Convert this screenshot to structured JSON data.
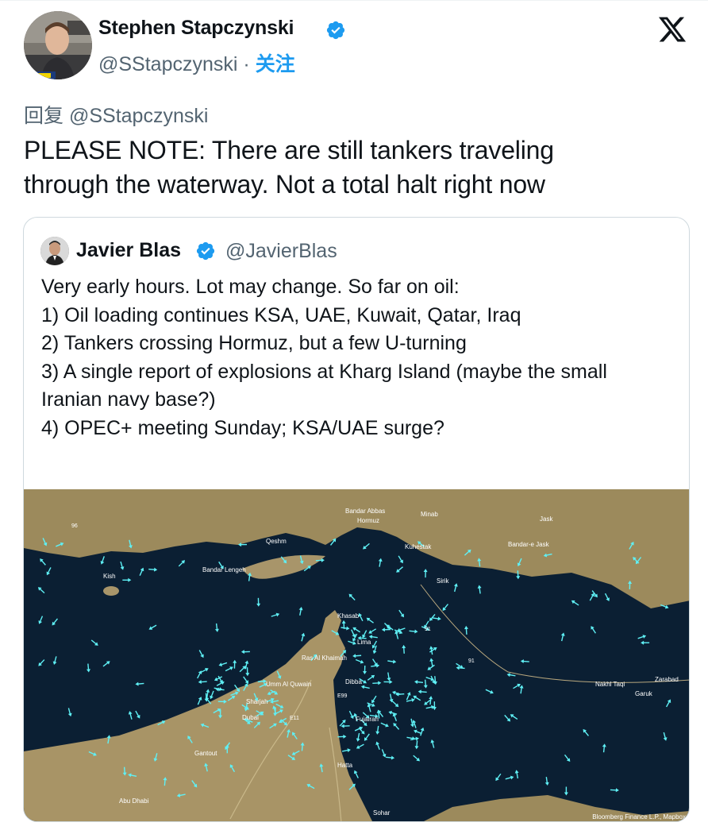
{
  "author": {
    "name": "Stephen Stapczynski",
    "handle": "@SStapczynski",
    "separator": "·",
    "follow_label": "关注"
  },
  "reply": {
    "prefix": "回复",
    "to_handle": "@SStapczynski"
  },
  "tweet_lines": [
    "PLEASE NOTE: There are still tankers traveling",
    "through the waterway. Not a total halt right now"
  ],
  "quoted": {
    "name": "Javier Blas",
    "handle": "@JavierBlas",
    "lines": [
      "Very early hours. Lot may change. So far on oil:",
      "",
      "1) Oil loading continues KSA, UAE, Kuwait, Qatar, Iraq",
      "2) Tankers crossing Hormuz, but a few U-turning",
      "3) A single report of explosions at Kharg Island (maybe the small",
      "Iranian navy base?)",
      "4) OPEC+ meeting Sunday; KSA/UAE surge?"
    ]
  },
  "map": {
    "places": [
      "Bandar Abbas",
      "Hormuz",
      "Minab",
      "Qeshm",
      "Kish",
      "Bandar Lengeh",
      "Khasab",
      "Lima",
      "Ras Al Khaimah",
      "Umm Al Quwain",
      "Sharjah",
      "Dubai",
      "Dibba",
      "Fujairah",
      "Gantout",
      "Hatta",
      "Abu Dhabi",
      "Sohar",
      "Jask",
      "Sirik",
      "Kuhestak",
      "Bandar-e Jask",
      "Nakhl Taqi",
      "Garuk",
      "Zarabad"
    ],
    "road_labels": [
      "91",
      "91",
      "96",
      "E11",
      "E99"
    ],
    "attribution": "Bloomberg Finance L.P., Mapbox"
  },
  "colors": {
    "verified": "#1d9bf0",
    "follow": "#1d9bf0",
    "muted": "#536471",
    "sea": "#0b1f33",
    "land": "#9c8a5c",
    "ship": "#5ff0f5"
  },
  "icons": {
    "verified": "verified-badge-icon",
    "brand": "x-logo-icon"
  }
}
